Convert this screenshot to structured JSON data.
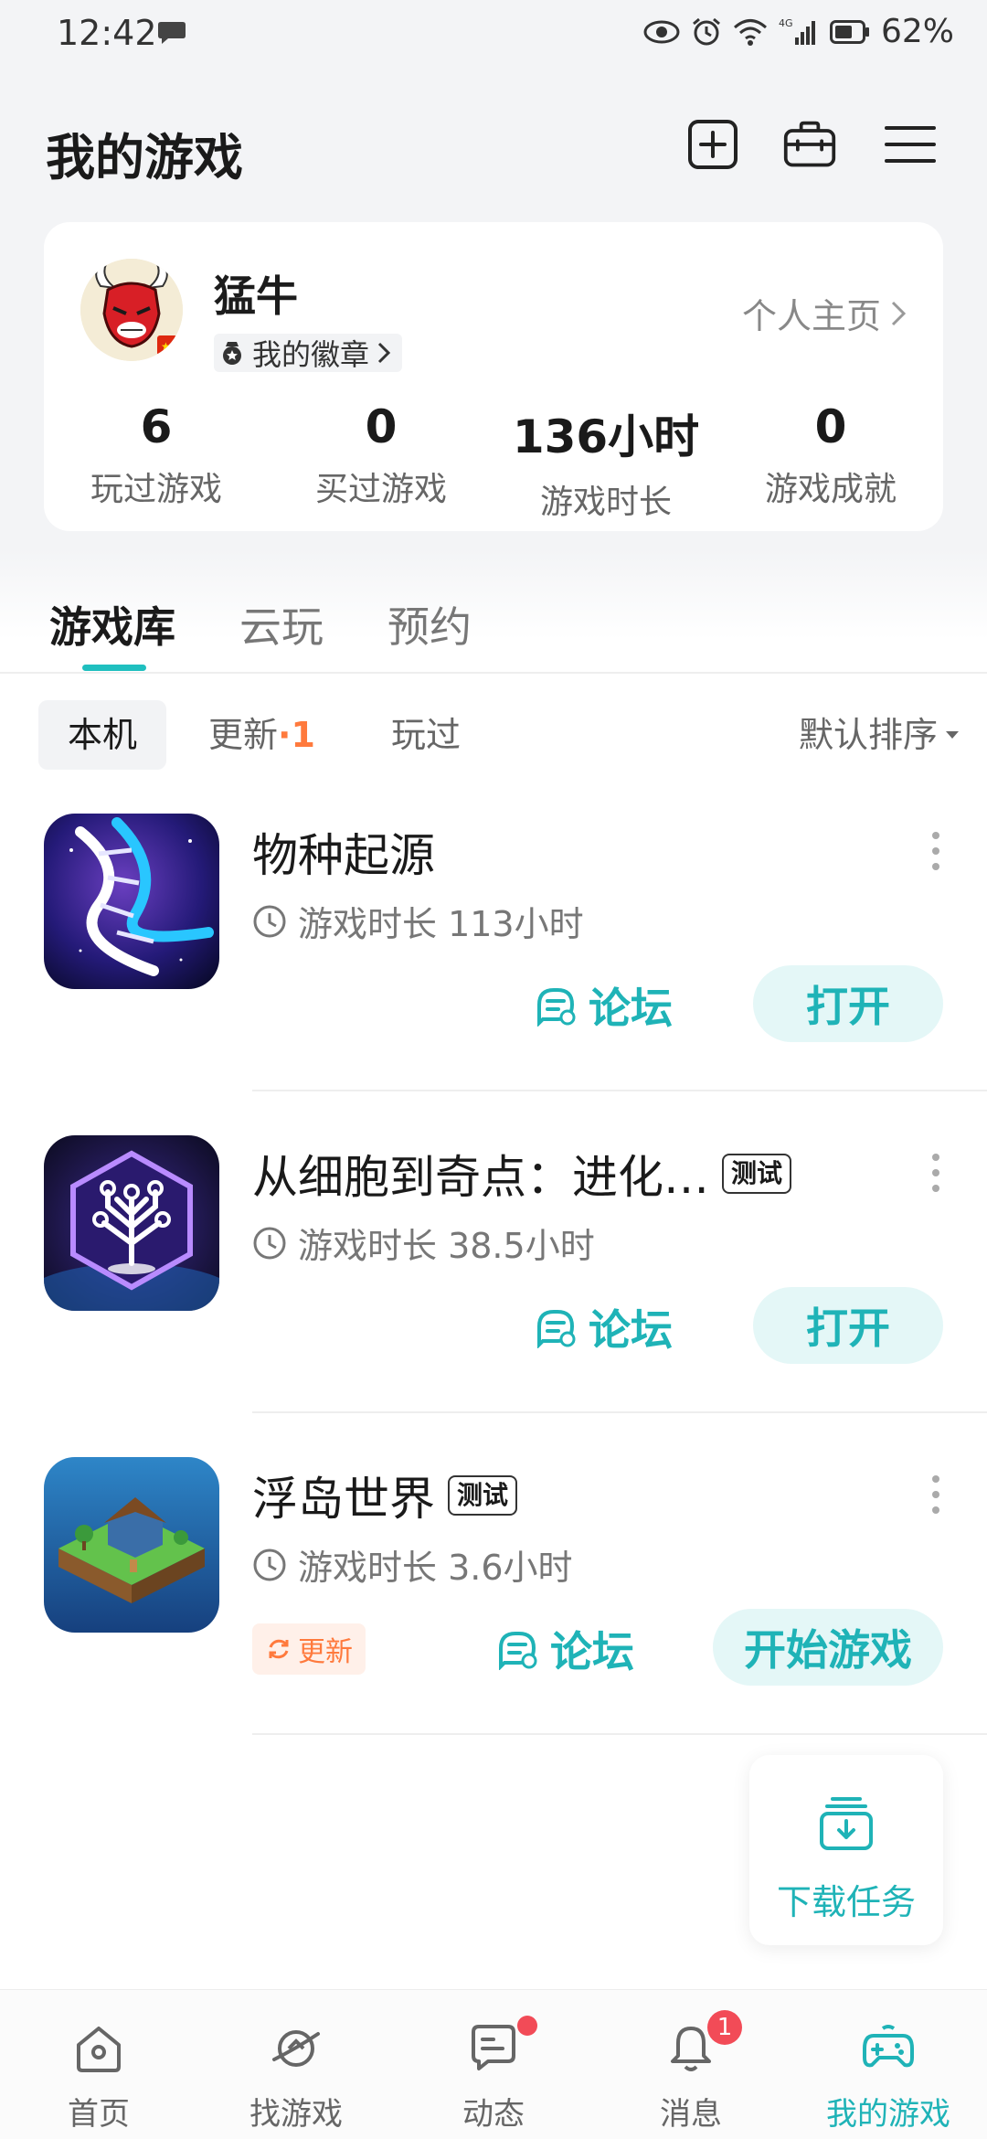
{
  "status_bar": {
    "time": "12:42",
    "battery": "62%",
    "network": "4G"
  },
  "header": {
    "title": "我的游戏"
  },
  "profile": {
    "name": "猛牛",
    "badge_label": "我的徽章",
    "homepage_label": "个人主页",
    "stats": [
      {
        "value": "6",
        "label": "玩过游戏"
      },
      {
        "value": "0",
        "label": "买过游戏"
      },
      {
        "value": "136小时",
        "label": "游戏时长"
      },
      {
        "value": "0",
        "label": "游戏成就"
      }
    ]
  },
  "tabs": [
    {
      "label": "游戏库",
      "active": true
    },
    {
      "label": "云玩",
      "active": false
    },
    {
      "label": "预约",
      "active": false
    }
  ],
  "filters": {
    "local": "本机",
    "update": "更新",
    "update_sep": "·",
    "update_count": "1",
    "played": "玩过",
    "sort": "默认排序"
  },
  "games": [
    {
      "name": "物种起源",
      "time": "游戏时长 113小时",
      "forum": "论坛",
      "action": "打开"
    },
    {
      "name": "从细胞到奇点：进化…",
      "tag": "测试",
      "time": "游戏时长 38.5小时",
      "forum": "论坛",
      "action": "打开"
    },
    {
      "name": "浮岛世界",
      "tag": "测试",
      "time": "游戏时长 3.6小时",
      "update": "更新",
      "forum": "论坛",
      "action": "开始游戏"
    }
  ],
  "download_fab": {
    "label": "下载任务"
  },
  "bottom_nav": [
    {
      "label": "首页"
    },
    {
      "label": "找游戏"
    },
    {
      "label": "动态"
    },
    {
      "label": "消息",
      "badge": "1"
    },
    {
      "label": "我的游戏"
    }
  ],
  "colors": {
    "accent": "#1fb3b7",
    "update_orange": "#ff7a3d",
    "badge_red": "#f24b57"
  }
}
